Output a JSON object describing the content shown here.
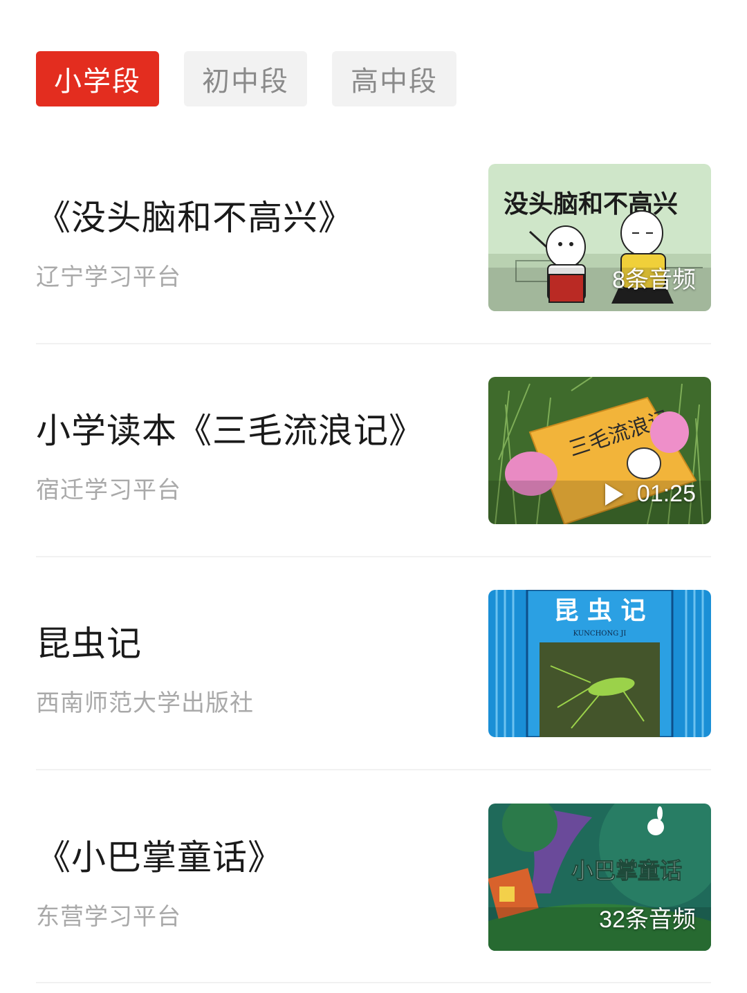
{
  "tabs": [
    {
      "label": "小学段",
      "active": true
    },
    {
      "label": "初中段",
      "active": false
    },
    {
      "label": "高中段",
      "active": false
    }
  ],
  "items": [
    {
      "title": "《没头脑和不高兴》",
      "source": "辽宁学习平台",
      "badge": "8条音频",
      "thumb_text": "没头脑和不高兴"
    },
    {
      "title": "小学读本《三毛流浪记》",
      "source": "宿迁学习平台",
      "badge": "01:25",
      "thumb_text": "三毛流浪记"
    },
    {
      "title": "昆虫记",
      "source": "西南师范大学出版社",
      "badge": "",
      "thumb_text": "昆 虫 记",
      "thumb_subtext": "KUNCHONG JI"
    },
    {
      "title": "《小巴掌童话》",
      "source": "东营学习平台",
      "badge": "32条音频",
      "thumb_text": "小巴掌童话"
    }
  ],
  "colors": {
    "accent": "#e32d1f",
    "tab_bg": "#f2f2f2",
    "source_text": "#a9a9a9"
  }
}
